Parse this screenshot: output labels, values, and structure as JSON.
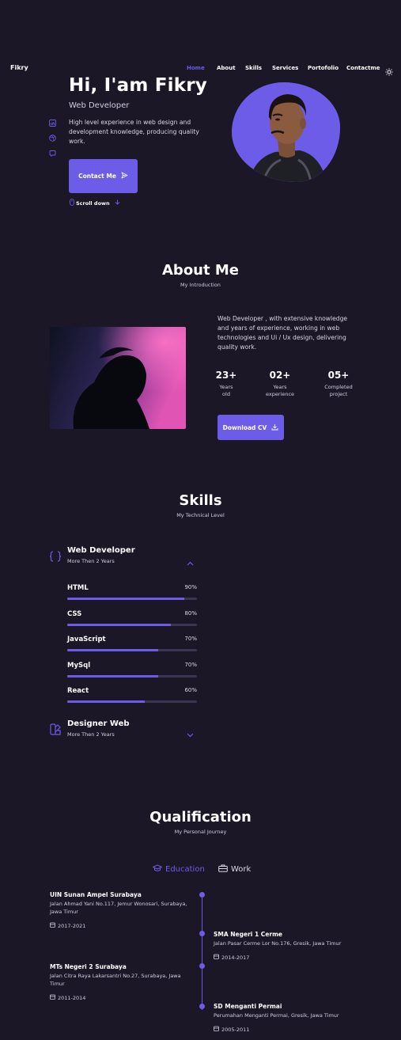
{
  "nav": {
    "logo": "Fikry",
    "items": [
      "Home",
      "About",
      "Skills",
      "Services",
      "Portofolio",
      "Contactme"
    ],
    "active": "Home",
    "theme_icon": "sun-icon"
  },
  "hero": {
    "title": "Hi, I'am Fikry",
    "subtitle": "Web Developer",
    "description": "High level experience in web design and development knowledge, producing quality work.",
    "contact_button": "Contact Me",
    "scroll_label": "Scroll down",
    "social_icons": [
      "linkedin-icon",
      "dribbble-icon",
      "github-icon"
    ]
  },
  "about": {
    "title": "About Me",
    "subtitle": "My Introduction",
    "description": "Web Developer , with extensive knowledge and years of experience, working in web technologies and Ui / Ux design, delivering quality work.",
    "stats": [
      {
        "value": "23+",
        "label_line1": "Years",
        "label_line2": "old"
      },
      {
        "value": "02+",
        "label_line1": "Years",
        "label_line2": "experience"
      },
      {
        "value": "05+",
        "label_line1": "Completed",
        "label_line2": "project"
      }
    ],
    "download_button": "Download CV"
  },
  "skills": {
    "title": "Skills",
    "subtitle": "My Technical Level",
    "groups": [
      {
        "title": "Web Developer",
        "sub": "More Then 2 Years",
        "items": [
          {
            "name": "HTML",
            "percent": "90%",
            "level": 0.9
          },
          {
            "name": "CSS",
            "percent": "80%",
            "level": 0.8
          },
          {
            "name": "JavaScript",
            "percent": "70%",
            "level": 0.7
          },
          {
            "name": "MySql",
            "percent": "70%",
            "level": 0.7
          },
          {
            "name": "React",
            "percent": "60%",
            "level": 0.6
          }
        ]
      },
      {
        "title": "Designer Web",
        "sub": "More Then 2 Years"
      }
    ]
  },
  "qualification": {
    "title": "Qualification",
    "subtitle": "My Personal Journey",
    "tabs": [
      "Education",
      "Work"
    ],
    "entries": [
      {
        "title": "UIN Sunan Ampel Surabaya",
        "sub": "Jalan Ahmad Yani No.117, Jemur Wonosari, Surabaya, Jawa Timur",
        "date": "2017-2021"
      },
      {
        "title": "SMA Negeri 1 Cerme",
        "sub": "Jalan Pasar Cerme Lor No.176, Gresik, Jawa Timur",
        "date": "2014-2017"
      },
      {
        "title": "MTs Negeri 2 Surabaya",
        "sub": "Jalan Citra Raya Lakarsantri No.27, Surabaya, Jawa Timur",
        "date": "2011-2014"
      },
      {
        "title": "SD Menganti Permai",
        "sub": "Perumahan Menganti Permai, Gresik, Jawa Timur",
        "date": "2005-2011"
      }
    ]
  },
  "colors": {
    "background": "#1b1727",
    "accent": "#6c5ce7",
    "text": "#ffffff",
    "muted": "#cfcde0"
  }
}
